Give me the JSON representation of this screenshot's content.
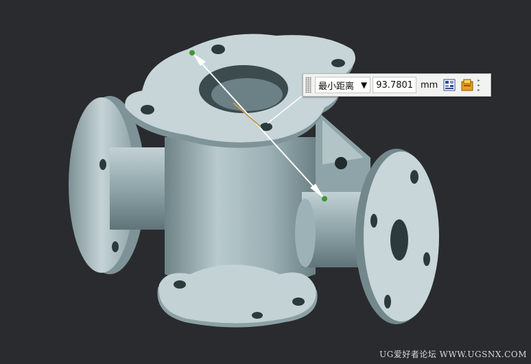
{
  "measure_toolbar": {
    "mode_label": "最小距离",
    "dropdown_arrow": "▼",
    "distance_value": "93.7801",
    "unit": "mm",
    "icons": [
      "data-table-icon",
      "warning-save-icon"
    ],
    "overflow_icon": "overflow-arrows-icon"
  },
  "watermark": {
    "text": "UG爱好者论坛 WWW.UGSNX.COM"
  },
  "colors": {
    "background": "#2a2b2e",
    "model_body": "#9fb4b8",
    "measure_point": "#3c9a2e",
    "measure_line": "#ffffff"
  }
}
